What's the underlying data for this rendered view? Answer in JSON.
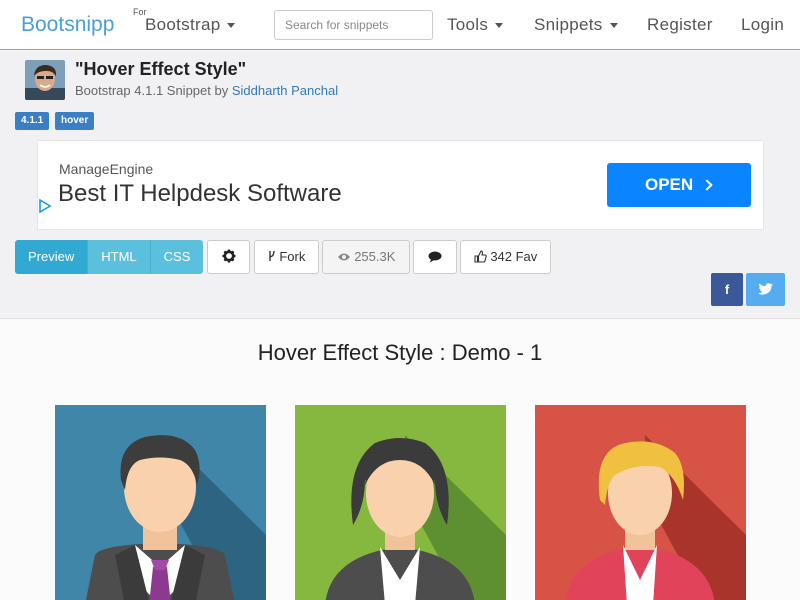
{
  "nav": {
    "brand": "Bootsnipp",
    "for_label": "For",
    "bootstrap": "Bootstrap",
    "search_placeholder": "Search for snippets",
    "tools": "Tools",
    "snippets": "Snippets",
    "register": "Register",
    "login": "Login"
  },
  "snippet": {
    "title": "\"Hover Effect Style\"",
    "subtitle_prefix": "Bootstrap 4.1.1 Snippet by",
    "author": "Siddharth Panchal",
    "tags": [
      "4.1.1",
      "hover"
    ]
  },
  "ad": {
    "brand": "ManageEngine",
    "headline": "Best IT Helpdesk Software",
    "cta": "OPEN"
  },
  "toolbar": {
    "tabs": [
      "Preview",
      "HTML",
      "CSS"
    ],
    "fork": "Fork",
    "views": "255.3K",
    "fav": "342 Fav"
  },
  "social": {
    "facebook": "f"
  },
  "demo": {
    "title": "Hover Effect Style : Demo - 1"
  },
  "colors": {
    "brand": "#4a9fd5",
    "tab": "#5bc0de",
    "ad_cta": "#0a84ff",
    "card_blue": "#3f86a8",
    "card_green": "#86b840",
    "card_red": "#d65346",
    "facebook": "#3b5998",
    "twitter": "#55acee"
  },
  "icons": [
    "caret-down-icon",
    "gear-icon",
    "fork-icon",
    "eye-icon",
    "comment-icon",
    "thumbs-up-icon",
    "facebook-icon",
    "twitter-icon",
    "ad-choices-icon",
    "chevron-right-icon"
  ]
}
